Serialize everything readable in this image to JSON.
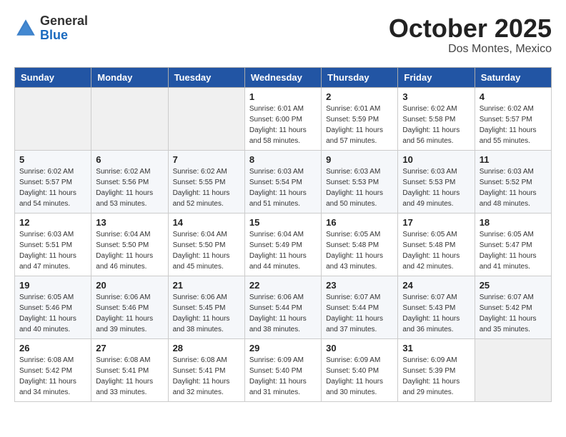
{
  "header": {
    "logo_general": "General",
    "logo_blue": "Blue",
    "month": "October 2025",
    "location": "Dos Montes, Mexico"
  },
  "days_of_week": [
    "Sunday",
    "Monday",
    "Tuesday",
    "Wednesday",
    "Thursday",
    "Friday",
    "Saturday"
  ],
  "weeks": [
    [
      {
        "day": "",
        "info": ""
      },
      {
        "day": "",
        "info": ""
      },
      {
        "day": "",
        "info": ""
      },
      {
        "day": "1",
        "info": "Sunrise: 6:01 AM\nSunset: 6:00 PM\nDaylight: 11 hours\nand 58 minutes."
      },
      {
        "day": "2",
        "info": "Sunrise: 6:01 AM\nSunset: 5:59 PM\nDaylight: 11 hours\nand 57 minutes."
      },
      {
        "day": "3",
        "info": "Sunrise: 6:02 AM\nSunset: 5:58 PM\nDaylight: 11 hours\nand 56 minutes."
      },
      {
        "day": "4",
        "info": "Sunrise: 6:02 AM\nSunset: 5:57 PM\nDaylight: 11 hours\nand 55 minutes."
      }
    ],
    [
      {
        "day": "5",
        "info": "Sunrise: 6:02 AM\nSunset: 5:57 PM\nDaylight: 11 hours\nand 54 minutes."
      },
      {
        "day": "6",
        "info": "Sunrise: 6:02 AM\nSunset: 5:56 PM\nDaylight: 11 hours\nand 53 minutes."
      },
      {
        "day": "7",
        "info": "Sunrise: 6:02 AM\nSunset: 5:55 PM\nDaylight: 11 hours\nand 52 minutes."
      },
      {
        "day": "8",
        "info": "Sunrise: 6:03 AM\nSunset: 5:54 PM\nDaylight: 11 hours\nand 51 minutes."
      },
      {
        "day": "9",
        "info": "Sunrise: 6:03 AM\nSunset: 5:53 PM\nDaylight: 11 hours\nand 50 minutes."
      },
      {
        "day": "10",
        "info": "Sunrise: 6:03 AM\nSunset: 5:53 PM\nDaylight: 11 hours\nand 49 minutes."
      },
      {
        "day": "11",
        "info": "Sunrise: 6:03 AM\nSunset: 5:52 PM\nDaylight: 11 hours\nand 48 minutes."
      }
    ],
    [
      {
        "day": "12",
        "info": "Sunrise: 6:03 AM\nSunset: 5:51 PM\nDaylight: 11 hours\nand 47 minutes."
      },
      {
        "day": "13",
        "info": "Sunrise: 6:04 AM\nSunset: 5:50 PM\nDaylight: 11 hours\nand 46 minutes."
      },
      {
        "day": "14",
        "info": "Sunrise: 6:04 AM\nSunset: 5:50 PM\nDaylight: 11 hours\nand 45 minutes."
      },
      {
        "day": "15",
        "info": "Sunrise: 6:04 AM\nSunset: 5:49 PM\nDaylight: 11 hours\nand 44 minutes."
      },
      {
        "day": "16",
        "info": "Sunrise: 6:05 AM\nSunset: 5:48 PM\nDaylight: 11 hours\nand 43 minutes."
      },
      {
        "day": "17",
        "info": "Sunrise: 6:05 AM\nSunset: 5:48 PM\nDaylight: 11 hours\nand 42 minutes."
      },
      {
        "day": "18",
        "info": "Sunrise: 6:05 AM\nSunset: 5:47 PM\nDaylight: 11 hours\nand 41 minutes."
      }
    ],
    [
      {
        "day": "19",
        "info": "Sunrise: 6:05 AM\nSunset: 5:46 PM\nDaylight: 11 hours\nand 40 minutes."
      },
      {
        "day": "20",
        "info": "Sunrise: 6:06 AM\nSunset: 5:46 PM\nDaylight: 11 hours\nand 39 minutes."
      },
      {
        "day": "21",
        "info": "Sunrise: 6:06 AM\nSunset: 5:45 PM\nDaylight: 11 hours\nand 38 minutes."
      },
      {
        "day": "22",
        "info": "Sunrise: 6:06 AM\nSunset: 5:44 PM\nDaylight: 11 hours\nand 38 minutes."
      },
      {
        "day": "23",
        "info": "Sunrise: 6:07 AM\nSunset: 5:44 PM\nDaylight: 11 hours\nand 37 minutes."
      },
      {
        "day": "24",
        "info": "Sunrise: 6:07 AM\nSunset: 5:43 PM\nDaylight: 11 hours\nand 36 minutes."
      },
      {
        "day": "25",
        "info": "Sunrise: 6:07 AM\nSunset: 5:42 PM\nDaylight: 11 hours\nand 35 minutes."
      }
    ],
    [
      {
        "day": "26",
        "info": "Sunrise: 6:08 AM\nSunset: 5:42 PM\nDaylight: 11 hours\nand 34 minutes."
      },
      {
        "day": "27",
        "info": "Sunrise: 6:08 AM\nSunset: 5:41 PM\nDaylight: 11 hours\nand 33 minutes."
      },
      {
        "day": "28",
        "info": "Sunrise: 6:08 AM\nSunset: 5:41 PM\nDaylight: 11 hours\nand 32 minutes."
      },
      {
        "day": "29",
        "info": "Sunrise: 6:09 AM\nSunset: 5:40 PM\nDaylight: 11 hours\nand 31 minutes."
      },
      {
        "day": "30",
        "info": "Sunrise: 6:09 AM\nSunset: 5:40 PM\nDaylight: 11 hours\nand 30 minutes."
      },
      {
        "day": "31",
        "info": "Sunrise: 6:09 AM\nSunset: 5:39 PM\nDaylight: 11 hours\nand 29 minutes."
      },
      {
        "day": "",
        "info": ""
      }
    ]
  ]
}
